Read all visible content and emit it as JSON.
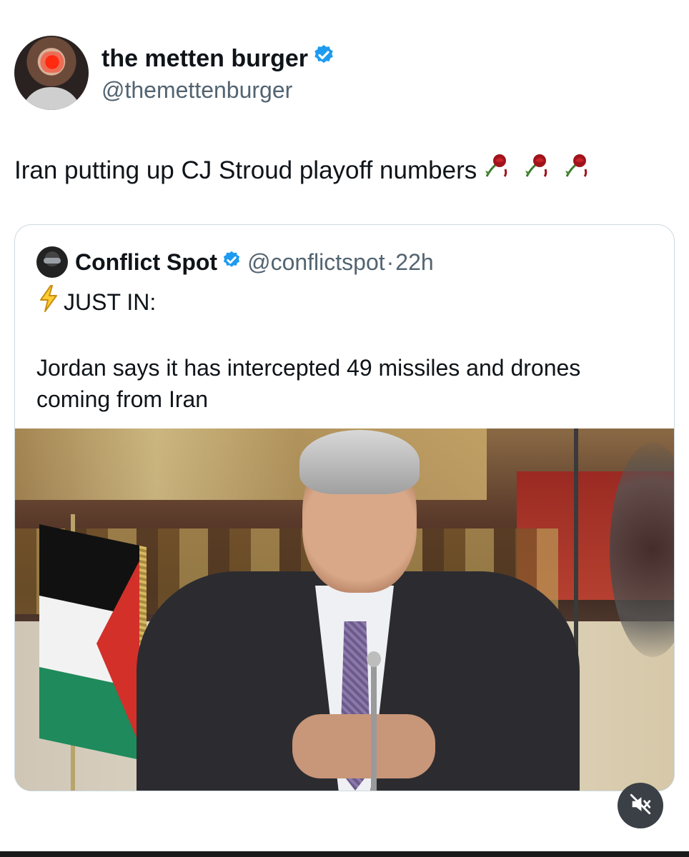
{
  "author": {
    "name": "the metten burger",
    "handle": "@themettenburger",
    "verified": true,
    "verified_color": "#1d9bf0"
  },
  "tweet": {
    "text": "Iran putting up CJ Stroud playoff numbers",
    "emoji": [
      "wilted-rose",
      "wilted-rose",
      "wilted-rose"
    ]
  },
  "quoted_tweet": {
    "author_name": "Conflict Spot",
    "handle": "@conflictspot",
    "separator": "·",
    "time": "22h",
    "verified": true,
    "headline": "JUST IN:",
    "body_lines": [
      "Jordan says it has intercepted 49 missiles and drones",
      "coming from Iran"
    ],
    "image": "photo of man in suit seated at desk beside flag"
  },
  "controls": {
    "mute_icon": "muted-speaker-icon"
  },
  "colors": {
    "text": "#0f1419",
    "secondary_text": "#536471",
    "border": "#cfd9de"
  }
}
